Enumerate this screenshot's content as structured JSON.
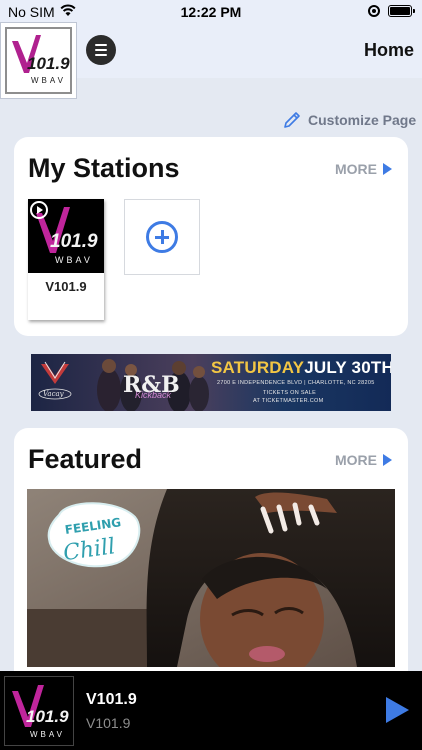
{
  "status_bar": {
    "carrier": "No SIM",
    "time": "12:22 PM"
  },
  "header": {
    "logo_text": "V101.9",
    "logo_sub": "WBAV",
    "title": "Home"
  },
  "customize": {
    "label": "Customize Page"
  },
  "my_stations": {
    "title": "My Stations",
    "more_label": "MORE",
    "stations": [
      {
        "label": "V101.9"
      }
    ]
  },
  "ad_banner": {
    "brand": "Vacay",
    "headline_day": "SATURDAY",
    "headline_date": "JULY 30TH",
    "address": "2700 E INDEPENDENCE BLVD  |  CHARLOTTE, NC 28205",
    "tickets_line1": "TICKETS ON SALE",
    "tickets_line2": "AT TICKETMASTER.COM",
    "event_title": "R&B",
    "event_sub": "Kickback"
  },
  "featured": {
    "title": "Featured",
    "more_label": "MORE",
    "sticker_line1": "FEELING",
    "sticker_line2": "Chill"
  },
  "now_playing": {
    "title": "V101.9",
    "subtitle": "V101.9"
  },
  "colors": {
    "accent": "#3e7be4",
    "logo_purple": "#b0218f",
    "background": "#e4e9f2"
  }
}
